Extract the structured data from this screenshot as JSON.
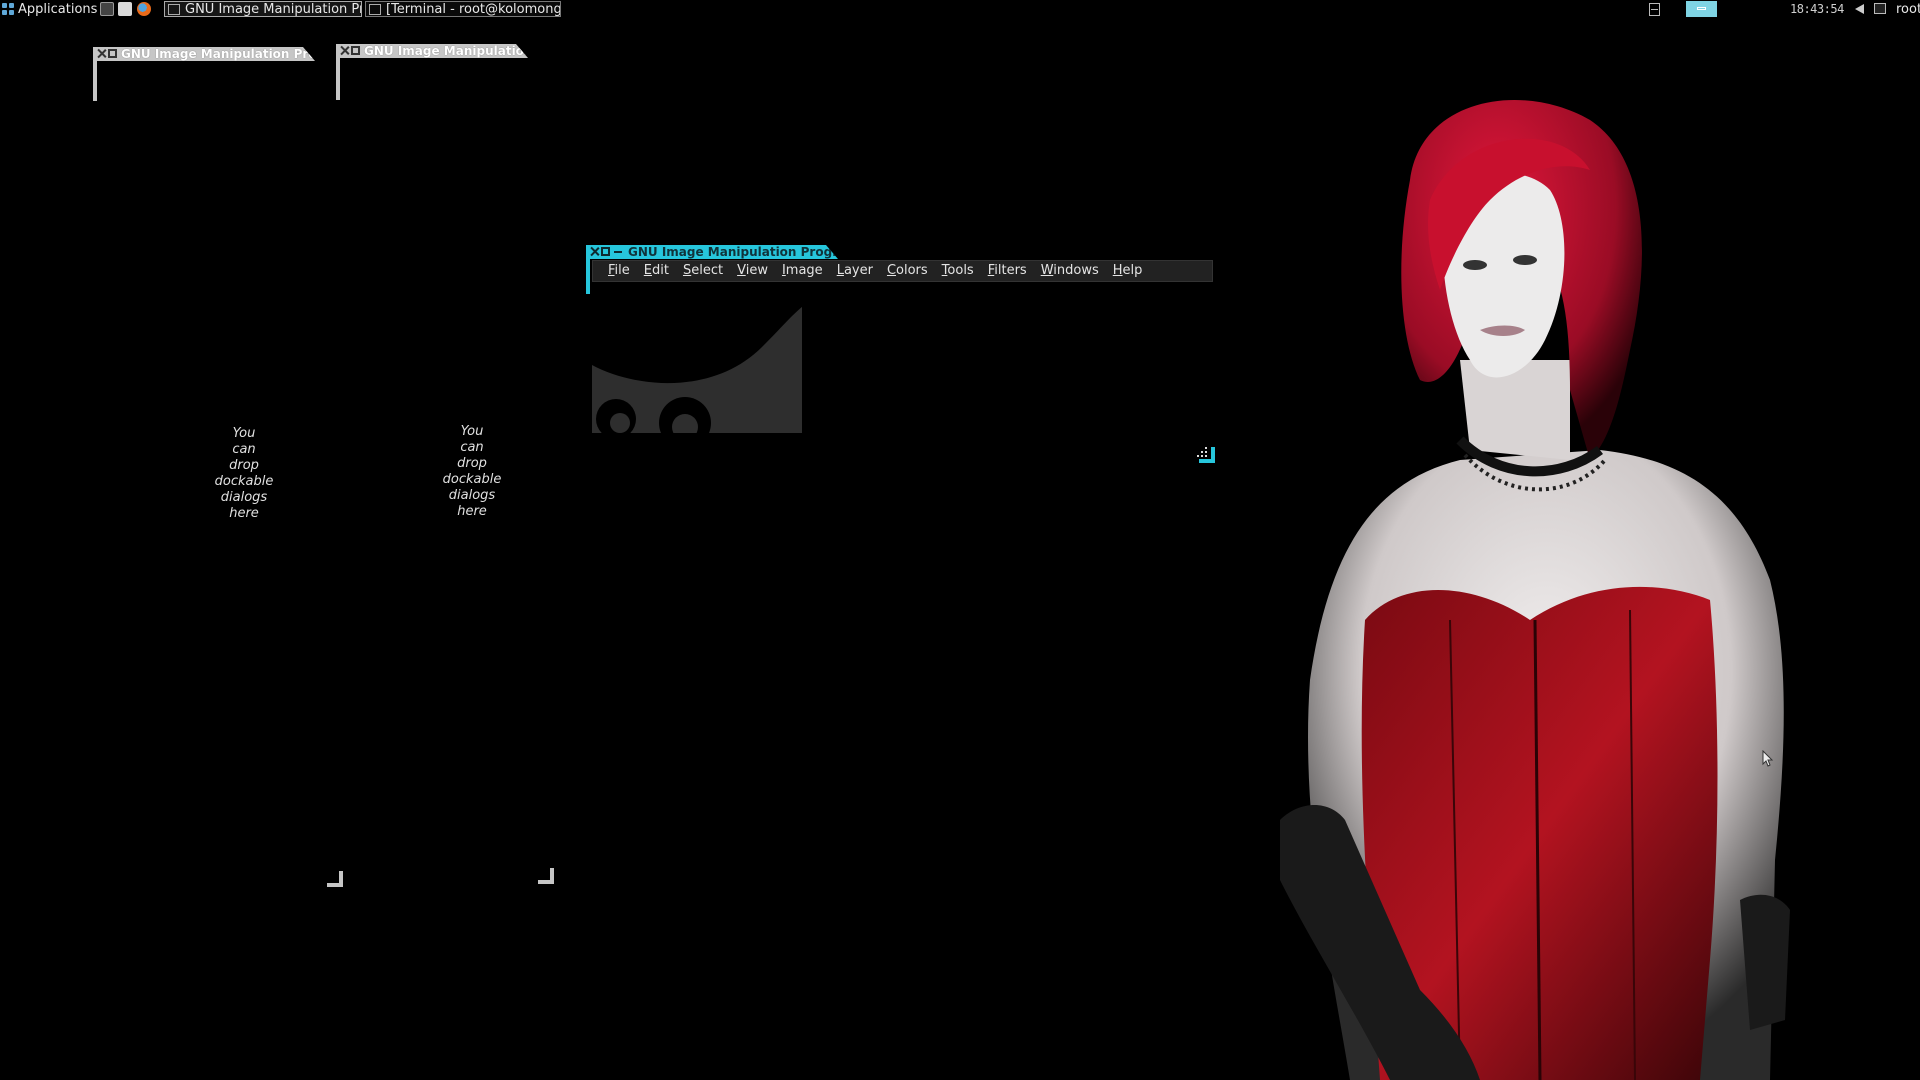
{
  "panel": {
    "applications_label": "Applications",
    "tasks": [
      {
        "label": "GNU Image Manipulation Pr..."
      },
      {
        "label": "[Terminal - root@kolomong..."
      }
    ],
    "clock": "18:43:54",
    "user": "root"
  },
  "colors": {
    "active_titlebar": "#26c6dc",
    "inactive_titlebar": "#c6c6c6",
    "desktop_bg": "#000000",
    "pager_active": "#7fd4e4"
  },
  "dock_windows": [
    {
      "title": "GNU Image Manipulation Progr",
      "drop_hint": [
        "You",
        "can",
        "drop",
        "dockable",
        "dialogs",
        "here"
      ]
    },
    {
      "title": "GNU Image Manipulation I",
      "drop_hint": [
        "You",
        "can",
        "drop",
        "dockable",
        "dialogs",
        "here"
      ]
    }
  ],
  "gimp_window": {
    "title": "GNU Image Manipulation Program",
    "menu": [
      "File",
      "Edit",
      "Select",
      "View",
      "Image",
      "Layer",
      "Colors",
      "Tools",
      "Filters",
      "Windows",
      "Help"
    ]
  },
  "icons": [
    "applications-menu-icon",
    "terminal-launcher-icon",
    "file-manager-launcher-icon",
    "firefox-launcher-icon",
    "gimp-task-icon",
    "terminal-task-icon",
    "pager-icon",
    "volume-icon",
    "network-icon",
    "close-icon",
    "maximize-icon",
    "resize-grip-icon",
    "wilber-mascot-icon",
    "mouse-cursor-icon"
  ]
}
